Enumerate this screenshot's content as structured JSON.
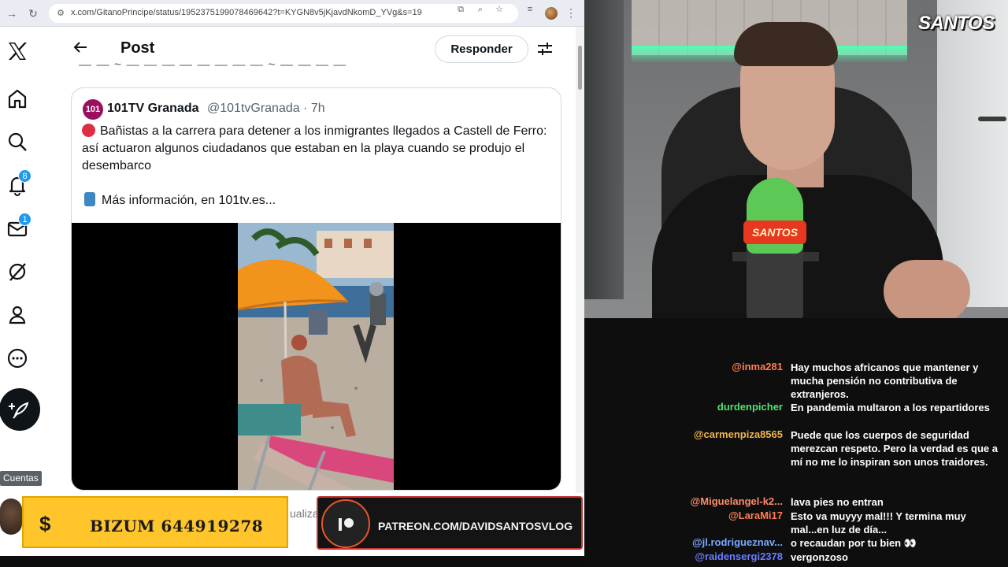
{
  "browser": {
    "url": "x.com/GitanoPrincipe/status/1952375199078469642?t=KYGN8v5jKjavdNkomD_YVg&s=19"
  },
  "x": {
    "badges": {
      "notifications": "8",
      "messages": "1"
    },
    "tooltip": "Cuentas",
    "header": {
      "title": "Post",
      "reply_label": "Responder"
    },
    "quote": {
      "avatar_text": "101",
      "name": "101TV Granada",
      "handle": "@101tvGranada · 7h",
      "text": "Bañistas a la carrera para detener a los inmigrantes llegados a Castell de Ferro: así actuaron algunos ciudadanos que estaban en la playa cuando se produjo el desembarco",
      "more": "Más información, en 101tv.es..."
    },
    "behind_text": "ualiza"
  },
  "overlays": {
    "bizum_symbol": "$",
    "bizum_text": "BIZUM 644919278",
    "patreon_text": "PATREON.COM/DAVIDSANTOSVLOG"
  },
  "stream": {
    "logo": "SANTOS",
    "mic_label": "SANTOS"
  },
  "chat": {
    "messages": [
      {
        "user": "@inma281",
        "color": "#ff7d52",
        "text": "Hay muchos africanos que mantener y mucha pensión no contributiva de extranjeros."
      },
      {
        "user": "durdenpicher",
        "color": "#4fe36a",
        "text": "En pandemia multaron a los repartidores"
      },
      {
        "user": "@carmenpiza8565",
        "color": "#f0b44c",
        "text": "Puede que los cuerpos de seguridad merezcan respeto. Pero la verdad es que a mí no me lo inspiran son unos traidores."
      },
      {
        "user": "@Miguelangel-k2...",
        "color": "#ff8a6a",
        "text": "lava pies no entran"
      },
      {
        "user": "@LaraMi17",
        "color": "#ff7d52",
        "text": "Esto va muyyy mal!!! Y termina muy mal...en luz de día..."
      },
      {
        "user": "@jl.rodrigueznav...",
        "color": "#7aa8ff",
        "text": "o recaudan por tu bien 👀"
      },
      {
        "user": "@raidensergi2378",
        "color": "#6a7dff",
        "text": "vergonzoso"
      }
    ]
  }
}
